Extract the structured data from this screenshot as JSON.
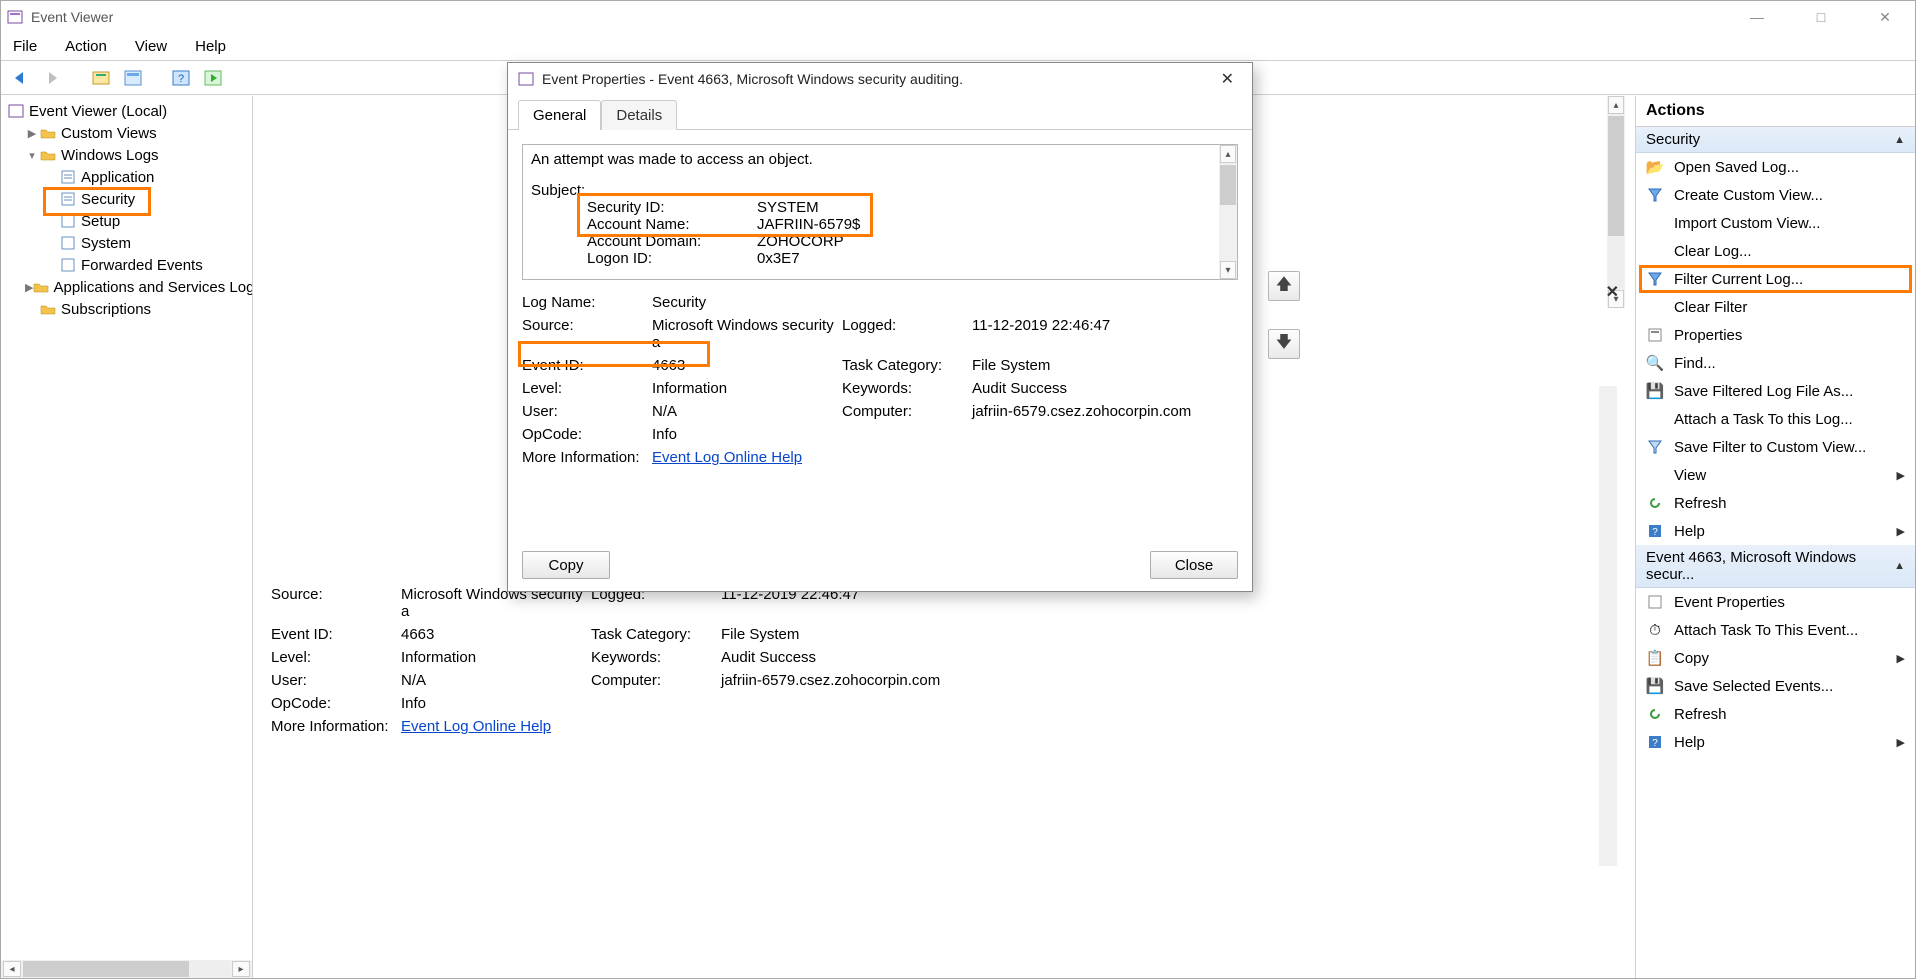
{
  "window": {
    "title": "Event Viewer",
    "minimize": "—",
    "maximize": "□",
    "close": "✕"
  },
  "menu": {
    "file": "File",
    "action": "Action",
    "view": "View",
    "help": "Help"
  },
  "tree": {
    "root": "Event Viewer (Local)",
    "custom_views": "Custom Views",
    "windows_logs": "Windows Logs",
    "application": "Application",
    "security": "Security",
    "setup": "Setup",
    "system": "System",
    "forwarded": "Forwarded Events",
    "apps_services": "Applications and Services Logs",
    "subscriptions": "Subscriptions"
  },
  "dialog": {
    "title": "Event Properties - Event 4663, Microsoft Windows security auditing.",
    "tab_general": "General",
    "tab_details": "Details",
    "desc_line1": "An attempt was made to access an object.",
    "subject_h": "Subject:",
    "sec_id_l": "Security ID:",
    "sec_id_v": "SYSTEM",
    "acct_name_l": "Account Name:",
    "acct_name_v": "JAFRIIN-6579$",
    "acct_dom_l": "Account Domain:",
    "acct_dom_v": "ZOHOCORP",
    "logon_id_l": "Logon ID:",
    "logon_id_v": "0x3E7",
    "logname_l": "Log Name:",
    "logname_v": "Security",
    "source_l": "Source:",
    "source_v": "Microsoft Windows security a",
    "logged_l": "Logged:",
    "logged_v": "11-12-2019 22:46:47",
    "eventid_l": "Event ID:",
    "eventid_v": "4663",
    "taskcat_l": "Task Category:",
    "taskcat_v": "File System",
    "level_l": "Level:",
    "level_v": "Information",
    "keywords_l": "Keywords:",
    "keywords_v": "Audit Success",
    "user_l": "User:",
    "user_v": "N/A",
    "computer_l": "Computer:",
    "computer_v": "jafriin-6579.csez.zohocorpin.com",
    "opcode_l": "OpCode:",
    "opcode_v": "Info",
    "moreinfo_l": "More Information:",
    "moreinfo_link": "Event Log Online Help",
    "copy": "Copy",
    "close": "Close"
  },
  "actions": {
    "heading": "Actions",
    "section1": "Security",
    "open_saved": "Open Saved Log...",
    "create_custom": "Create Custom View...",
    "import_custom": "Import Custom View...",
    "clear_log": "Clear Log...",
    "filter_current": "Filter Current Log...",
    "clear_filter": "Clear Filter",
    "properties": "Properties",
    "find": "Find...",
    "save_filtered": "Save Filtered Log File As...",
    "attach_task_log": "Attach a Task To this Log...",
    "save_filter_custom": "Save Filter to Custom View...",
    "view": "View",
    "refresh": "Refresh",
    "help": "Help",
    "section2": "Event 4663, Microsoft Windows secur...",
    "event_properties": "Event Properties",
    "attach_task_event": "Attach Task To This Event...",
    "copy": "Copy",
    "save_selected": "Save Selected Events...",
    "refresh2": "Refresh",
    "help2": "Help"
  },
  "center_close": "✕"
}
